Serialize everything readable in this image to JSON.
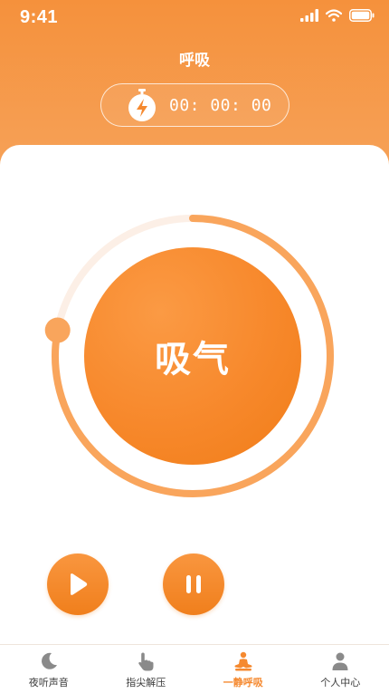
{
  "status_bar": {
    "time": "9:41"
  },
  "header": {
    "title": "呼吸"
  },
  "timer": {
    "display": "00: 00: 00"
  },
  "breath": {
    "label": "吸气",
    "progress": 0.78
  },
  "controls": {
    "play": "play",
    "pause": "pause"
  },
  "tabbar": {
    "items": [
      {
        "label": "夜听声音",
        "icon": "moon-icon",
        "active": false
      },
      {
        "label": "指尖解压",
        "icon": "hand-pointer-icon",
        "active": false
      },
      {
        "label": "一静呼吸",
        "icon": "meditation-icon",
        "active": true
      },
      {
        "label": "个人中心",
        "icon": "user-icon",
        "active": false
      }
    ]
  },
  "colors": {
    "accent": "#f5892f",
    "ring_track": "#fcefe6",
    "ring_progress": "#f9a55c"
  }
}
